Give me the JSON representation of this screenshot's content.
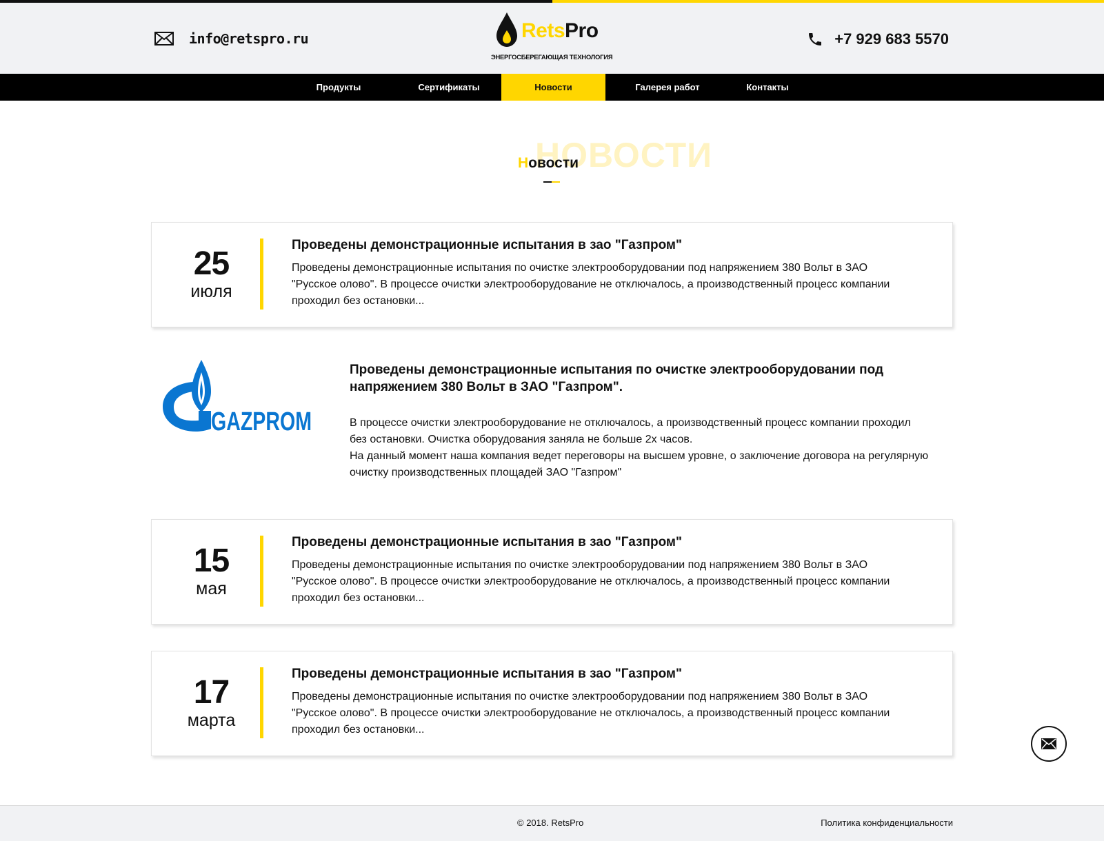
{
  "colors": {
    "accent": "#ffd600",
    "dark": "#111111",
    "nav_bg": "#000000",
    "header_bg": "#f1f2f4",
    "gazprom_blue": "#0a76d1"
  },
  "header": {
    "email": "info@retspro.ru",
    "brand_part1": "Rets",
    "brand_part2": "Pro",
    "tagline": "ЭНЕРГОСБЕРЕГАЮЩАЯ ТЕХНОЛОГИЯ",
    "phone": "+7 929 683 5570"
  },
  "nav": {
    "items": [
      {
        "label": "Продукты"
      },
      {
        "label": "Сертификаты"
      },
      {
        "label": "Новости",
        "active": true
      },
      {
        "label": "Галерея работ"
      },
      {
        "label": "Контакты"
      }
    ]
  },
  "section": {
    "bg_title": "НОВОСТИ",
    "title_first": "Н",
    "title_rest": "овости"
  },
  "news": [
    {
      "day": "25",
      "month": "июля",
      "title": "Проведены демонстрационные испытания в зао \"Газпром\"",
      "text": "Проведены демонстрационные испытания по очистке электрооборудовании под напряжением 380 Вольт в ЗАО \"Русское олово\". В процессе очистки электрооборудование не отключалось, а производственный процесс компании проходил без остановки..."
    },
    {
      "day": "15",
      "month": "мая",
      "title": "Проведены демонстрационные испытания в зао \"Газпром\"",
      "text": "Проведены демонстрационные испытания по очистке электрооборудовании под напряжением 380 Вольт в ЗАО \"Русское олово\". В процессе очистки электрооборудование не отключалось, а производственный процесс компании проходил без остановки..."
    },
    {
      "day": "17",
      "month": "марта",
      "title": "Проведены демонстрационные испытания в зао \"Газпром\"",
      "text": "Проведены демонстрационные испытания по очистке электрооборудовании под напряжением 380 Вольт в ЗАО \"Русское олово\". В процессе очистки электрооборудование не отключалось, а производственный процесс компании проходил без остановки..."
    }
  ],
  "featured": {
    "logo_text": "GAZPROM",
    "title": "Проведены демонстрационные испытания по очистке электрооборудовании под напряжением 380 Вольт в ЗАО \"Газпром\".",
    "para1": "В процессе очистки электрооборудование не отключалось, а производственный процесс компании проходил без остановки. Очистка оборудования заняла не больше 2х часов.",
    "para2": "На данный момент наша компания ведет переговоры на высшем уровне, о заключение договора на регулярную очистку производственных площадей ЗАО \"Газпром\""
  },
  "footer": {
    "copyright": "© 2018. RetsPro",
    "policy": "Политика конфиденциальности"
  }
}
